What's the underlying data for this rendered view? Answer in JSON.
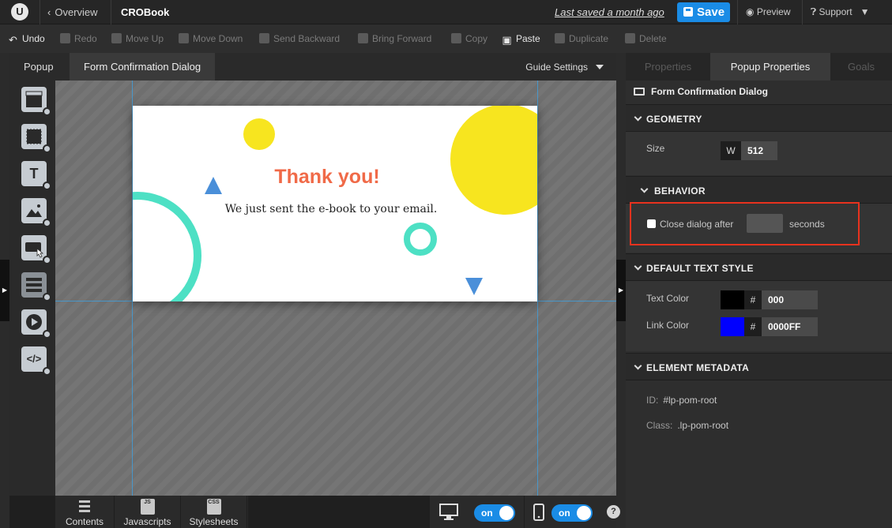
{
  "topbar": {
    "logo": "U",
    "back_label": "Overview",
    "doc_title": "CROBook",
    "last_saved": "Last saved  a month ago",
    "save_label": "Save",
    "preview_label": "Preview",
    "support_label": "Support"
  },
  "toolbar": {
    "undo": "Undo",
    "redo": "Redo",
    "move_up": "Move Up",
    "move_down": "Move Down",
    "send_backward": "Send Backward",
    "bring_forward": "Bring Forward",
    "copy": "Copy",
    "paste": "Paste",
    "duplicate": "Duplicate",
    "delete": "Delete"
  },
  "editor": {
    "tabs": [
      {
        "label": "Popup"
      },
      {
        "label": "Form Confirmation Dialog"
      }
    ],
    "guide_settings": "Guide Settings",
    "widget_text_label": "T",
    "dialog": {
      "heading": "Thank you!",
      "message": "We just sent the e-book to your email.",
      "colors": {
        "yellow": "#f7e51f",
        "teal": "#4de0c4",
        "blue": "#4a8fd9",
        "heading": "#f06a48"
      }
    },
    "bottom": {
      "contents": "Contents",
      "javascripts": "Javascripts",
      "js_badge": "JS",
      "stylesheets": "Stylesheets",
      "css_badge": "CSS",
      "desktop_toggle": "on",
      "mobile_toggle": "on",
      "help": "?"
    }
  },
  "panel": {
    "tabs": [
      {
        "label": "Properties"
      },
      {
        "label": "Popup Properties"
      },
      {
        "label": "Goals"
      }
    ],
    "title": "Form Confirmation Dialog",
    "geometry": {
      "heading": "GEOMETRY",
      "size_label": "Size",
      "w_label": "W",
      "width": "512"
    },
    "behavior": {
      "heading": "BEHAVIOR",
      "close_label": "Close dialog after",
      "seconds_label": "seconds"
    },
    "text_style": {
      "heading": "DEFAULT TEXT STYLE",
      "text_color_label": "Text Color",
      "text_color": "000",
      "link_color_label": "Link Color",
      "link_color": "0000FF",
      "hash": "#"
    },
    "metadata": {
      "heading": "ELEMENT METADATA",
      "id_label": "ID:",
      "id_value": "#lp-pom-root",
      "class_label": "Class:",
      "class_value": ".lp-pom-root"
    }
  },
  "accent": "#1a8ce6",
  "highlight_color": "#e8321e"
}
